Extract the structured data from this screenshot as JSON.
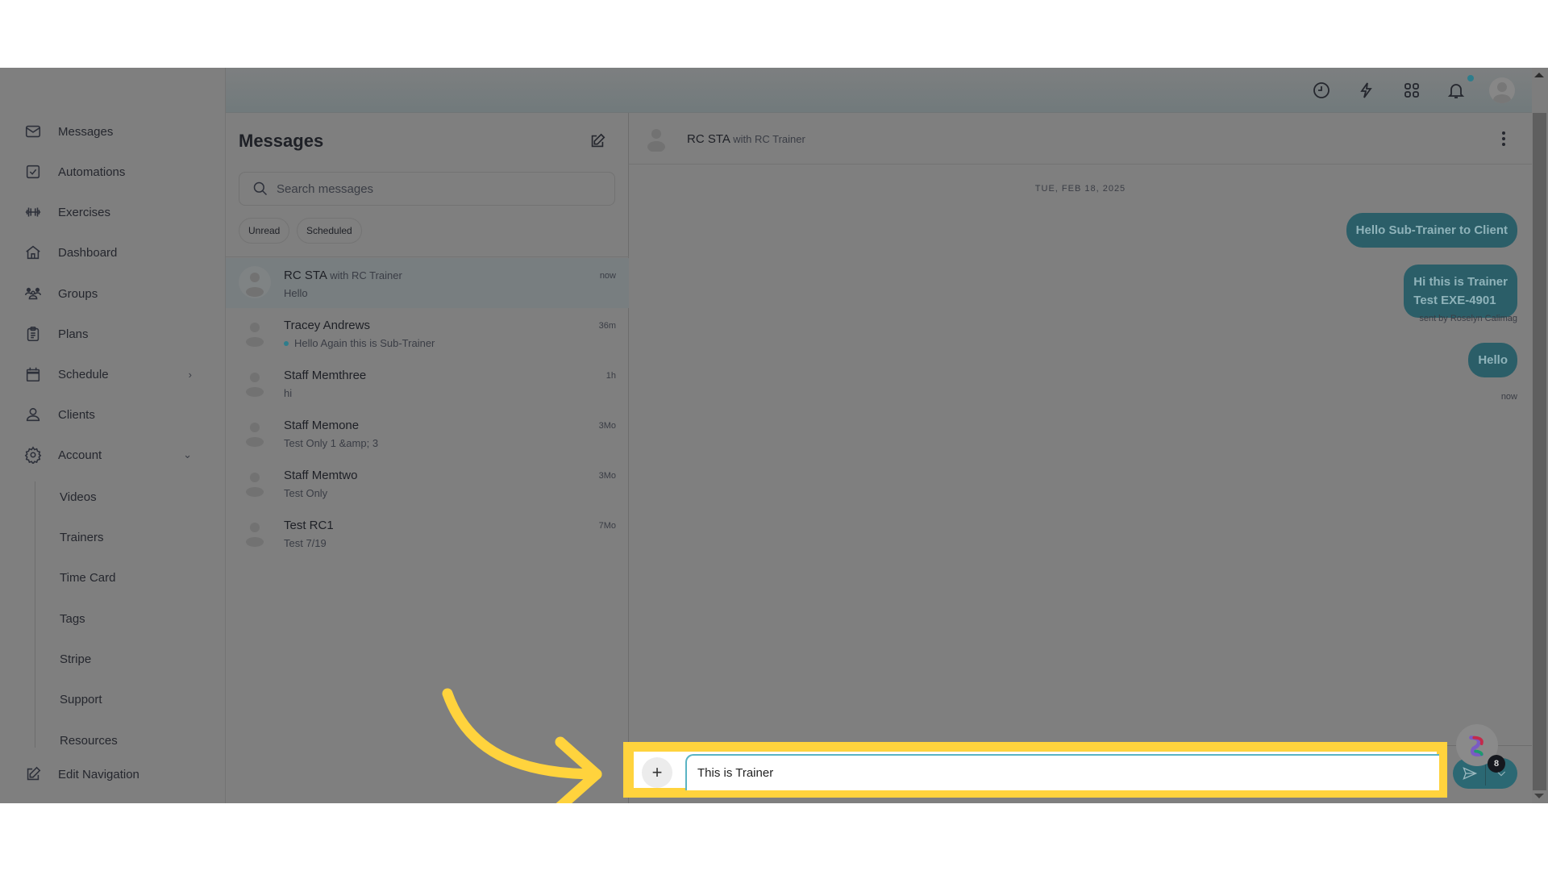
{
  "sidebar": {
    "items": [
      {
        "label": "Messages",
        "icon": "mail-icon"
      },
      {
        "label": "Automations",
        "icon": "checkbox-icon"
      },
      {
        "label": "Exercises",
        "icon": "dumbbell-icon"
      },
      {
        "label": "Dashboard",
        "icon": "home-icon"
      },
      {
        "label": "Groups",
        "icon": "users-icon"
      },
      {
        "label": "Plans",
        "icon": "clipboard-icon"
      },
      {
        "label": "Schedule",
        "icon": "calendar-icon",
        "chevron": ">"
      },
      {
        "label": "Clients",
        "icon": "user-icon"
      },
      {
        "label": "Account",
        "icon": "gear-icon",
        "chevron": "v"
      }
    ],
    "account_subitems": [
      "Videos",
      "Trainers",
      "Time Card",
      "Tags",
      "Stripe",
      "Support",
      "Resources"
    ],
    "edit_navigation": "Edit Navigation"
  },
  "topbar": {
    "icons": [
      "clock-icon",
      "lightning-icon",
      "apps-grid-icon",
      "bell-icon",
      "avatar"
    ],
    "notification_dot": true
  },
  "conversations": {
    "title": "Messages",
    "search_placeholder": "Search messages",
    "filters": [
      "Unread",
      "Scheduled"
    ],
    "items": [
      {
        "name": "RC STA",
        "with": "with RC Trainer",
        "preview": "Hello",
        "time": "now",
        "active": true,
        "unread": false
      },
      {
        "name": "Tracey Andrews",
        "with": "",
        "preview": "Hello Again this is Sub-Trainer",
        "time": "36m",
        "active": false,
        "unread": true
      },
      {
        "name": "Staff Memthree",
        "with": "",
        "preview": "hi",
        "time": "1h",
        "active": false,
        "unread": false
      },
      {
        "name": "Staff Memone",
        "with": "",
        "preview": "Test Only 1 &amp; 3",
        "time": "3Mo",
        "active": false,
        "unread": false
      },
      {
        "name": "Staff Memtwo",
        "with": "",
        "preview": "Test Only",
        "time": "3Mo",
        "active": false,
        "unread": false
      },
      {
        "name": "Test RC1",
        "with": "",
        "preview": "Test 7/19",
        "time": "7Mo",
        "active": false,
        "unread": false
      }
    ]
  },
  "chat": {
    "name": "RC STA",
    "with": "with RC Trainer",
    "date_separator": "TUE, FEB 18, 2025",
    "messages": [
      {
        "lines": [
          "Hello Sub-Trainer to Client"
        ],
        "meta": ""
      },
      {
        "lines": [
          "Hi this is Trainer",
          "Test EXE-4901"
        ],
        "meta": "sent by Roselyn Calimag"
      },
      {
        "lines": [
          "Hello"
        ],
        "meta": "now"
      }
    ],
    "composer": {
      "value": "This is Trainer",
      "attach_label": "+"
    },
    "widget_badge": "8"
  },
  "colors": {
    "accent": "#2b6873",
    "highlight": "#ffd33d",
    "input_focus": "#5ab4c4",
    "unread_dot": "#2e7d8c"
  }
}
